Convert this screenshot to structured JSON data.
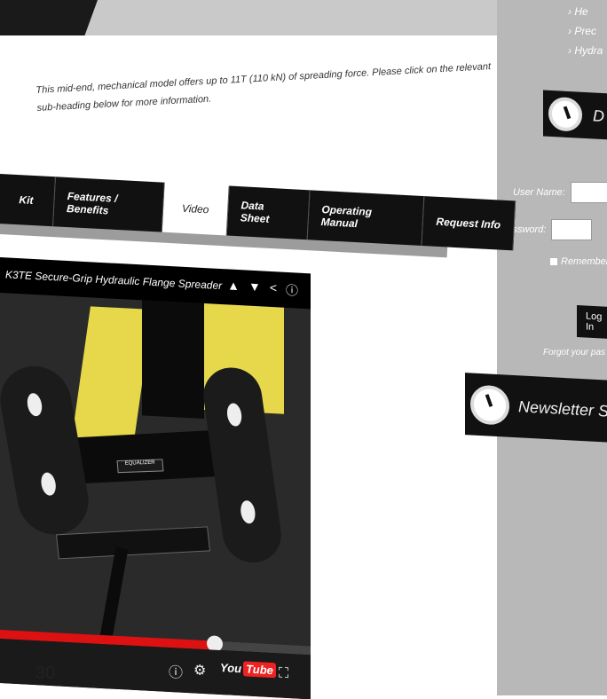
{
  "sidebar": {
    "nav_items": [
      "He",
      "Prec",
      "Hydra"
    ],
    "login_widget_title": "D",
    "username_label": "User Name:",
    "password_label": "Password:",
    "remember_label": "Remember",
    "login_button": "Log In",
    "forgot_link": "Forgot your pas",
    "newsletter_title": "Newsletter S"
  },
  "main": {
    "intro_text": "This mid-end, mechanical model offers up to 11T (110 kN) of spreading force. Please click on the relevant sub-heading below for more information.",
    "tabs": [
      "Kit",
      "Features / Benefits",
      "Video",
      "Data Sheet",
      "Operating Manual",
      "Request Info"
    ],
    "active_tab": "Video"
  },
  "video": {
    "title": "K3TE Secure-Grip Hydraulic Flange Spreader",
    "brand_label": "EQUALIZER",
    "progress_fraction": 0.69,
    "youtube_label": "You",
    "youtube_tube": "Tube"
  },
  "page_number": "30",
  "colors": {
    "accent_red": "#dd1111",
    "sidebar_gray": "#b8b8b8",
    "tab_black": "#111111",
    "yellow_frame": "#e6d84a"
  },
  "icons": {
    "video_top": [
      "thumbs-up-icon",
      "thumbs-down-icon",
      "share-icon",
      "info-icon"
    ],
    "video_controls": [
      "info-icon",
      "gear-icon",
      "fullscreen-icon"
    ]
  }
}
